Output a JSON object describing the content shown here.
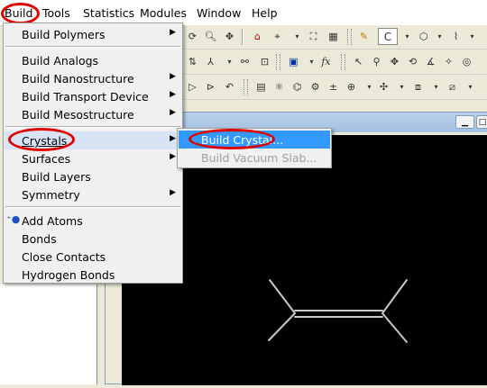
{
  "menubar": {
    "items": [
      {
        "label": "Build"
      },
      {
        "label": "Tools"
      },
      {
        "label": "Statistics"
      },
      {
        "label": "Modules"
      },
      {
        "label": "Window"
      },
      {
        "label": "Help"
      }
    ]
  },
  "toolbar": {
    "element_field": "C"
  },
  "build_menu": {
    "items": [
      {
        "label": "Build Polymers",
        "submenu": true
      },
      {
        "label": "Build Analogs",
        "submenu": false
      },
      {
        "label": "Build Nanostructure",
        "submenu": true
      },
      {
        "label": "Build Transport Device",
        "submenu": true
      },
      {
        "label": "Build Mesostructure",
        "submenu": true
      },
      {
        "label": "Crystals",
        "submenu": true
      },
      {
        "label": "Surfaces",
        "submenu": true
      },
      {
        "label": "Build Layers",
        "submenu": false
      },
      {
        "label": "Symmetry",
        "submenu": true
      },
      {
        "label": "Add Atoms",
        "submenu": false
      },
      {
        "label": "Bonds",
        "submenu": false
      },
      {
        "label": "Close Contacts",
        "submenu": false
      },
      {
        "label": "Hydrogen Bonds",
        "submenu": false
      }
    ]
  },
  "crystals_submenu": {
    "items": [
      {
        "label": "Build Crystal...",
        "enabled": true,
        "selected": true
      },
      {
        "label": "Build Vacuum Slab...",
        "enabled": false,
        "selected": false
      }
    ]
  },
  "colors": {
    "highlight": "#3399ff",
    "annotation_ring": "#e00000",
    "canvas": "#000000",
    "bond": "#c8c8c8"
  }
}
